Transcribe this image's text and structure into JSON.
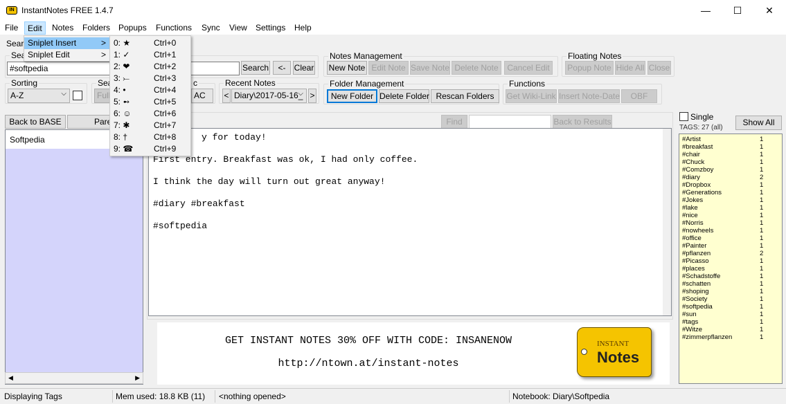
{
  "window": {
    "title": "InstantNotes FREE 1.4.7",
    "icon": "IN",
    "minimize": "—",
    "maximize": "☐",
    "close": "✕"
  },
  "menubar": [
    "File",
    "Edit",
    "Notes",
    "Folders",
    "Popups",
    "Functions",
    "Sync",
    "View",
    "Settings",
    "Help"
  ],
  "edit_menu": {
    "items": [
      {
        "label": "Sniplet Insert",
        "arrow": ">"
      },
      {
        "label": "Sniplet Edit",
        "arrow": ">"
      }
    ]
  },
  "sniplet_menu": [
    {
      "label": "0: ★",
      "shortcut": "Ctrl+0"
    },
    {
      "label": "1: ✓",
      "shortcut": "Ctrl+1"
    },
    {
      "label": "2: ❤",
      "shortcut": "Ctrl+2"
    },
    {
      "label": "3: ⤚",
      "shortcut": "Ctrl+3"
    },
    {
      "label": "4: •",
      "shortcut": "Ctrl+4"
    },
    {
      "label": "5: ➻",
      "shortcut": "Ctrl+5"
    },
    {
      "label": "6: ☺",
      "shortcut": "Ctrl+6"
    },
    {
      "label": "7: ✱",
      "shortcut": "Ctrl+7"
    },
    {
      "label": "8: †",
      "shortcut": "Ctrl+8"
    },
    {
      "label": "9: ☎",
      "shortcut": "Ctrl+9"
    }
  ],
  "search": {
    "tab": "Searc",
    "group": "Sea",
    "value": "#softpedia",
    "search_btn": "Search",
    "back_btn": "<-",
    "clear_btn": "Clear"
  },
  "sorting": {
    "label": "Sorting",
    "value": "A-Z",
    "checked": false
  },
  "search_mode": {
    "label": "Sea",
    "value": "Full"
  },
  "encoding": {
    "label": "c",
    "value": "AC"
  },
  "recent": {
    "label": "Recent Notes",
    "value": "Diary\\2017-05-16_",
    "prev": "<",
    "next": ">"
  },
  "notes_mgmt": {
    "label": "Notes Management",
    "buttons": [
      "New Note",
      "Edit Note",
      "Save Note",
      "Delete Note",
      "Cancel Edit"
    ]
  },
  "floating": {
    "label": "Floating Notes",
    "buttons": [
      "Popup Note",
      "Hide All",
      "Close"
    ]
  },
  "folder_mgmt": {
    "label": "Folder Management",
    "buttons": [
      "New Folder",
      "Delete Folder",
      "Rescan Folders"
    ]
  },
  "functions": {
    "label": "Functions",
    "buttons": [
      "Get Wiki-Link",
      "Insert Note-Date",
      "OBF"
    ]
  },
  "nav": {
    "back_base": "Back to BASE",
    "parent": "Pare"
  },
  "folders": [
    "Softpedia"
  ],
  "find": {
    "label": "Find",
    "value": "",
    "back": "Back to Results"
  },
  "note_lines": [
    "y for today!",
    "First entry. Breakfast was ok, I had only coffee.",
    "I think the day will turn out great anyway!",
    "#diary #breakfast",
    "#softpedia"
  ],
  "ad": {
    "line1": "GET INSTANT NOTES 30% OFF WITH CODE: INSANENOW",
    "line2": "http://ntown.at/instant-notes",
    "logo_top": "INSTANT",
    "logo_bottom": "Notes"
  },
  "tags_panel": {
    "single": "Single",
    "single_checked": false,
    "show_all": "Show All",
    "count": "TAGS: 27 (all)",
    "tags": [
      [
        "#Artist",
        1
      ],
      [
        "#breakfast",
        1
      ],
      [
        "#chair",
        1
      ],
      [
        "#Chuck",
        1
      ],
      [
        "#Comzboy",
        1
      ],
      [
        "#diary",
        2
      ],
      [
        "#Dropbox",
        1
      ],
      [
        "#Generations",
        1
      ],
      [
        "#Jokes",
        1
      ],
      [
        "#lake",
        1
      ],
      [
        "#nice",
        1
      ],
      [
        "#Norris",
        1
      ],
      [
        "#nowheels",
        1
      ],
      [
        "#office",
        1
      ],
      [
        "#Painter",
        1
      ],
      [
        "#pflanzen",
        2
      ],
      [
        "#Picasso",
        1
      ],
      [
        "#places",
        1
      ],
      [
        "#Schadstoffe",
        1
      ],
      [
        "#schatten",
        1
      ],
      [
        "#shoping",
        1
      ],
      [
        "#Society",
        1
      ],
      [
        "#softpedia",
        1
      ],
      [
        "#sun",
        1
      ],
      [
        "#tags",
        1
      ],
      [
        "#Witze",
        1
      ],
      [
        "#zimmerpflanzen",
        1
      ]
    ]
  },
  "status": {
    "mode": "Displaying Tags",
    "mem": "Mem used: 18.8 KB (11)",
    "opened": "<nothing opened>",
    "notebook": "Notebook: Diary\\Softpedia"
  },
  "colors": {
    "folder_bg": "#d4d4fb",
    "tags_bg": "#ffffd0",
    "logo": "#f5c400",
    "accent": "#0078d7"
  }
}
